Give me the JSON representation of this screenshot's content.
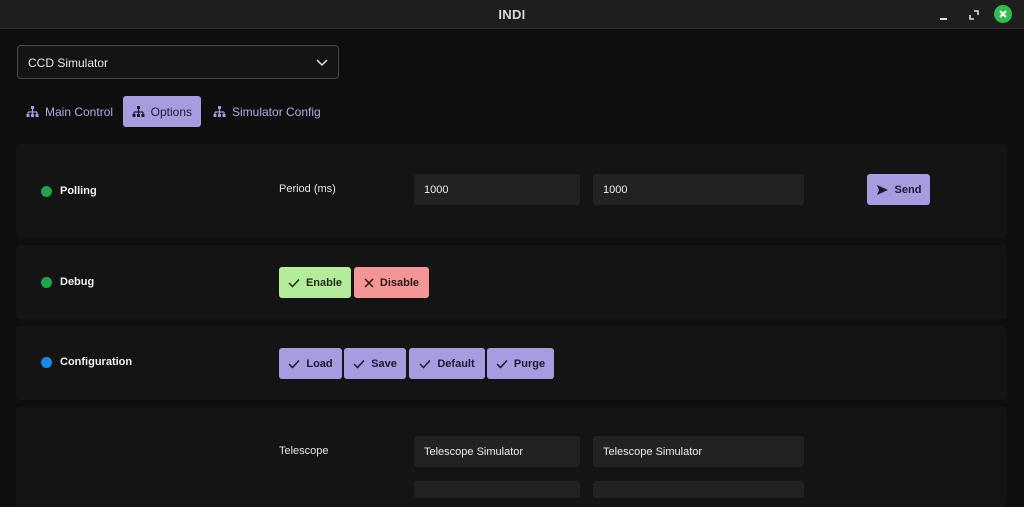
{
  "window": {
    "title": "INDI",
    "close_color": "#2fbf4f"
  },
  "device_select": {
    "value": "CCD Simulator"
  },
  "tabs": [
    {
      "label": "Main Control",
      "icon": "hierarchy-icon",
      "active": false
    },
    {
      "label": "Options",
      "icon": "hierarchy-icon",
      "active": true
    },
    {
      "label": "Simulator Config",
      "icon": "hierarchy-icon",
      "active": false
    }
  ],
  "properties": {
    "polling": {
      "name": "Polling",
      "status_color": "#1ea54a",
      "element_label": "Period (ms)",
      "current_value": "1000",
      "new_value": "1000",
      "send_label": "Send"
    },
    "debug": {
      "name": "Debug",
      "status_color": "#1ea54a",
      "enable_label": "Enable",
      "disable_label": "Disable"
    },
    "configuration": {
      "name": "Configuration",
      "status_color": "#1e88e5",
      "load_label": "Load",
      "save_label": "Save",
      "default_label": "Default",
      "purge_label": "Purge"
    },
    "snoop": {
      "element_label": "Telescope",
      "current_value": "Telescope Simulator",
      "new_value": "Telescope Simulator"
    }
  },
  "colors": {
    "accent": "#a99be0",
    "enable": "#b5ec9c",
    "disable": "#f59696"
  }
}
